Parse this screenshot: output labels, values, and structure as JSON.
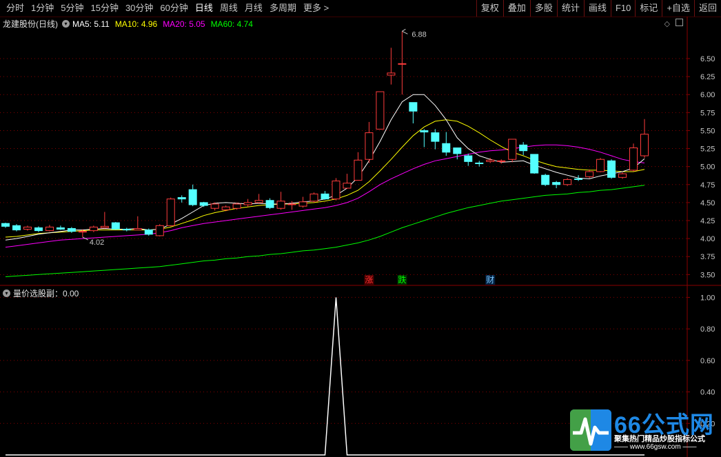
{
  "toolbar": {
    "periods": [
      "分时",
      "1分钟",
      "5分钟",
      "15分钟",
      "30分钟",
      "60分钟",
      "日线",
      "周线",
      "月线",
      "多周期",
      "更多 >"
    ],
    "active_period": "日线",
    "actions": [
      "复权",
      "叠加",
      "多股",
      "统计",
      "画线",
      "F10",
      "标记",
      "+自选",
      "返回"
    ]
  },
  "main_panel": {
    "stock_title": "龙建股份(日线)",
    "ma": [
      {
        "label": "MA5: 5.11",
        "color": "#ffffff"
      },
      {
        "label": "MA10: 4.96",
        "color": "#ffff00"
      },
      {
        "label": "MA20: 5.05",
        "color": "#ff00ff"
      },
      {
        "label": "MA60: 4.74",
        "color": "#00ff00"
      }
    ],
    "high_label": "6.88",
    "low_label": "4.02",
    "markers": [
      {
        "text": "涨",
        "color": "#ff3030",
        "bg": "#4a0000"
      },
      {
        "text": "跌",
        "color": "#00ff00",
        "bg": "#003000"
      },
      {
        "text": "财",
        "color": "#7ec8ff",
        "bg": "#002040"
      }
    ]
  },
  "sub_panel": {
    "title": "量价选股副：0.00"
  },
  "watermark": {
    "brand": "66公式网",
    "tagline": "聚集热门精品炒股指标公式",
    "url": "—— www.66gsw.com ——"
  },
  "colors": {
    "up": "#ff3c3c",
    "down": "#54ffff",
    "grid": "#8b0000",
    "axis": "#c8c8c8"
  },
  "chart_data": [
    {
      "type": "candlestick",
      "title": "龙建股份(日线)",
      "ylim": [
        3.35,
        6.95
      ],
      "y_ticks": [
        3.5,
        3.75,
        4.0,
        4.25,
        4.5,
        4.75,
        5.0,
        5.25,
        5.5,
        5.75,
        6.0,
        6.25,
        6.5
      ],
      "candles": [
        [
          4.21,
          4.17,
          4.22,
          4.15
        ],
        [
          4.18,
          4.12,
          4.2,
          4.1
        ],
        [
          4.13,
          4.16,
          4.18,
          4.11
        ],
        [
          4.15,
          4.11,
          4.17,
          4.09
        ],
        [
          4.11,
          4.16,
          4.19,
          4.1
        ],
        [
          4.15,
          4.13,
          4.18,
          4.12
        ],
        [
          4.14,
          4.1,
          4.16,
          4.08
        ],
        [
          4.1,
          4.1,
          4.13,
          4.02
        ],
        [
          4.11,
          4.16,
          4.18,
          4.09
        ],
        [
          4.15,
          4.17,
          4.37,
          4.14
        ],
        [
          4.22,
          4.13,
          4.23,
          4.12
        ],
        [
          4.13,
          4.12,
          4.15,
          4.1
        ],
        [
          4.12,
          4.14,
          4.31,
          4.12
        ],
        [
          4.12,
          4.06,
          4.14,
          4.04
        ],
        [
          4.04,
          4.18,
          4.2,
          4.03
        ],
        [
          4.18,
          4.55,
          4.57,
          4.17
        ],
        [
          4.57,
          4.55,
          4.6,
          4.5
        ],
        [
          4.68,
          4.47,
          4.75,
          4.45
        ],
        [
          4.5,
          4.46,
          4.51,
          4.44
        ],
        [
          4.42,
          4.48,
          4.5,
          4.39
        ],
        [
          4.4,
          4.44,
          4.46,
          4.38
        ],
        [
          4.42,
          4.48,
          4.5,
          4.4
        ],
        [
          4.47,
          4.5,
          4.55,
          4.44
        ],
        [
          4.5,
          4.53,
          4.62,
          4.49
        ],
        [
          4.53,
          4.43,
          4.56,
          4.41
        ],
        [
          4.42,
          4.52,
          4.65,
          4.4
        ],
        [
          4.48,
          4.48,
          4.52,
          4.4
        ],
        [
          4.45,
          4.51,
          4.58,
          4.43
        ],
        [
          4.52,
          4.62,
          4.64,
          4.5
        ],
        [
          4.62,
          4.55,
          4.66,
          4.54
        ],
        [
          4.55,
          4.8,
          4.84,
          4.53
        ],
        [
          4.7,
          4.77,
          4.9,
          4.69
        ],
        [
          4.81,
          5.09,
          5.2,
          4.81
        ],
        [
          5.1,
          5.47,
          5.62,
          5.05
        ],
        [
          5.52,
          6.04,
          6.04,
          5.52
        ],
        [
          6.27,
          6.3,
          6.65,
          6.14
        ],
        [
          6.43,
          6.43,
          6.88,
          6.0
        ],
        [
          5.89,
          5.77,
          5.89,
          5.6
        ],
        [
          5.5,
          5.48,
          5.52,
          5.27
        ],
        [
          5.47,
          5.35,
          5.52,
          5.24
        ],
        [
          5.32,
          5.2,
          5.48,
          5.15
        ],
        [
          5.26,
          5.18,
          5.26,
          5.1
        ],
        [
          5.15,
          5.07,
          5.18,
          5.01
        ],
        [
          5.05,
          5.04,
          5.08,
          5.0
        ],
        [
          5.07,
          5.09,
          5.12,
          5.05
        ],
        [
          5.07,
          5.08,
          5.1,
          5.04
        ],
        [
          5.1,
          5.38,
          5.38,
          5.06
        ],
        [
          5.3,
          5.22,
          5.34,
          5.16
        ],
        [
          5.17,
          4.91,
          5.17,
          4.9
        ],
        [
          4.88,
          4.75,
          4.9,
          4.73
        ],
        [
          4.78,
          4.75,
          4.8,
          4.7
        ],
        [
          4.75,
          4.82,
          4.84,
          4.73
        ],
        [
          4.83,
          4.82,
          4.88,
          4.8
        ],
        [
          4.86,
          4.93,
          4.96,
          4.84
        ],
        [
          4.93,
          5.1,
          5.12,
          4.92
        ],
        [
          5.08,
          4.85,
          5.1,
          4.83
        ],
        [
          4.85,
          4.9,
          4.92,
          4.83
        ],
        [
          4.95,
          5.26,
          5.32,
          4.93
        ],
        [
          5.15,
          5.45,
          5.66,
          5.12
        ]
      ],
      "ma5": [
        3.98,
        4.0,
        4.03,
        4.06,
        4.08,
        4.1,
        4.12,
        4.12,
        4.13,
        4.14,
        4.13,
        4.13,
        4.14,
        4.12,
        4.13,
        4.2,
        4.28,
        4.37,
        4.46,
        4.49,
        4.5,
        4.49,
        4.48,
        4.49,
        4.48,
        4.48,
        4.49,
        4.51,
        4.52,
        4.55,
        4.6,
        4.7,
        4.85,
        5.08,
        5.35,
        5.65,
        5.9,
        6.0,
        6.0,
        5.85,
        5.65,
        5.4,
        5.25,
        5.15,
        5.1,
        5.06,
        5.07,
        5.08,
        5.02,
        4.97,
        4.92,
        4.88,
        4.84,
        4.83,
        4.87,
        4.9,
        4.93,
        4.98,
        5.11
      ],
      "ma10": [
        4.02,
        4.03,
        4.05,
        4.07,
        4.08,
        4.09,
        4.1,
        4.11,
        4.12,
        4.12,
        4.12,
        4.12,
        4.12,
        4.12,
        4.13,
        4.16,
        4.21,
        4.26,
        4.32,
        4.36,
        4.39,
        4.42,
        4.44,
        4.46,
        4.47,
        4.48,
        4.48,
        4.49,
        4.5,
        4.52,
        4.55,
        4.6,
        4.67,
        4.79,
        4.94,
        5.1,
        5.27,
        5.43,
        5.55,
        5.63,
        5.65,
        5.63,
        5.56,
        5.47,
        5.37,
        5.28,
        5.2,
        5.15,
        5.09,
        5.04,
        5.0,
        4.98,
        4.96,
        4.95,
        4.95,
        4.94,
        4.93,
        4.93,
        4.96
      ],
      "ma20": [
        3.88,
        3.9,
        3.92,
        3.94,
        3.96,
        3.98,
        3.99,
        4.0,
        4.01,
        4.02,
        4.03,
        4.04,
        4.05,
        4.06,
        4.08,
        4.11,
        4.15,
        4.18,
        4.21,
        4.23,
        4.25,
        4.27,
        4.29,
        4.31,
        4.33,
        4.35,
        4.37,
        4.39,
        4.41,
        4.43,
        4.46,
        4.5,
        4.56,
        4.65,
        4.75,
        4.83,
        4.9,
        4.97,
        5.03,
        5.08,
        5.11,
        5.14,
        5.17,
        5.2,
        5.22,
        5.23,
        5.25,
        5.27,
        5.29,
        5.3,
        5.3,
        5.29,
        5.27,
        5.24,
        5.2,
        5.15,
        5.1,
        5.07,
        5.05
      ],
      "ma60": [
        3.47,
        3.48,
        3.49,
        3.5,
        3.51,
        3.52,
        3.53,
        3.54,
        3.55,
        3.56,
        3.57,
        3.58,
        3.59,
        3.6,
        3.61,
        3.63,
        3.65,
        3.67,
        3.69,
        3.7,
        3.72,
        3.73,
        3.75,
        3.76,
        3.78,
        3.79,
        3.81,
        3.83,
        3.84,
        3.86,
        3.88,
        3.91,
        3.94,
        3.98,
        4.03,
        4.09,
        4.15,
        4.2,
        4.25,
        4.3,
        4.35,
        4.39,
        4.43,
        4.46,
        4.49,
        4.52,
        4.54,
        4.56,
        4.58,
        4.6,
        4.61,
        4.62,
        4.64,
        4.65,
        4.67,
        4.68,
        4.7,
        4.72,
        4.74
      ]
    },
    {
      "type": "line",
      "title": "量价选股副：0.00",
      "ylim": [
        0,
        1.05
      ],
      "y_ticks": [
        0.2,
        0.4,
        0.6,
        0.8,
        1.0
      ],
      "spike_index": 30,
      "values_note_free": true,
      "values": [
        0,
        0,
        0,
        0,
        0,
        0,
        0,
        0,
        0,
        0,
        0,
        0,
        0,
        0,
        0,
        0,
        0,
        0,
        0,
        0,
        0,
        0,
        0,
        0,
        0,
        0,
        0,
        0,
        0,
        0,
        1,
        0,
        0,
        0,
        0,
        0,
        0,
        0,
        0,
        0,
        0,
        0,
        0,
        0,
        0,
        0,
        0,
        0,
        0,
        0,
        0,
        0,
        0,
        0,
        0,
        0,
        0,
        0,
        0
      ]
    }
  ]
}
